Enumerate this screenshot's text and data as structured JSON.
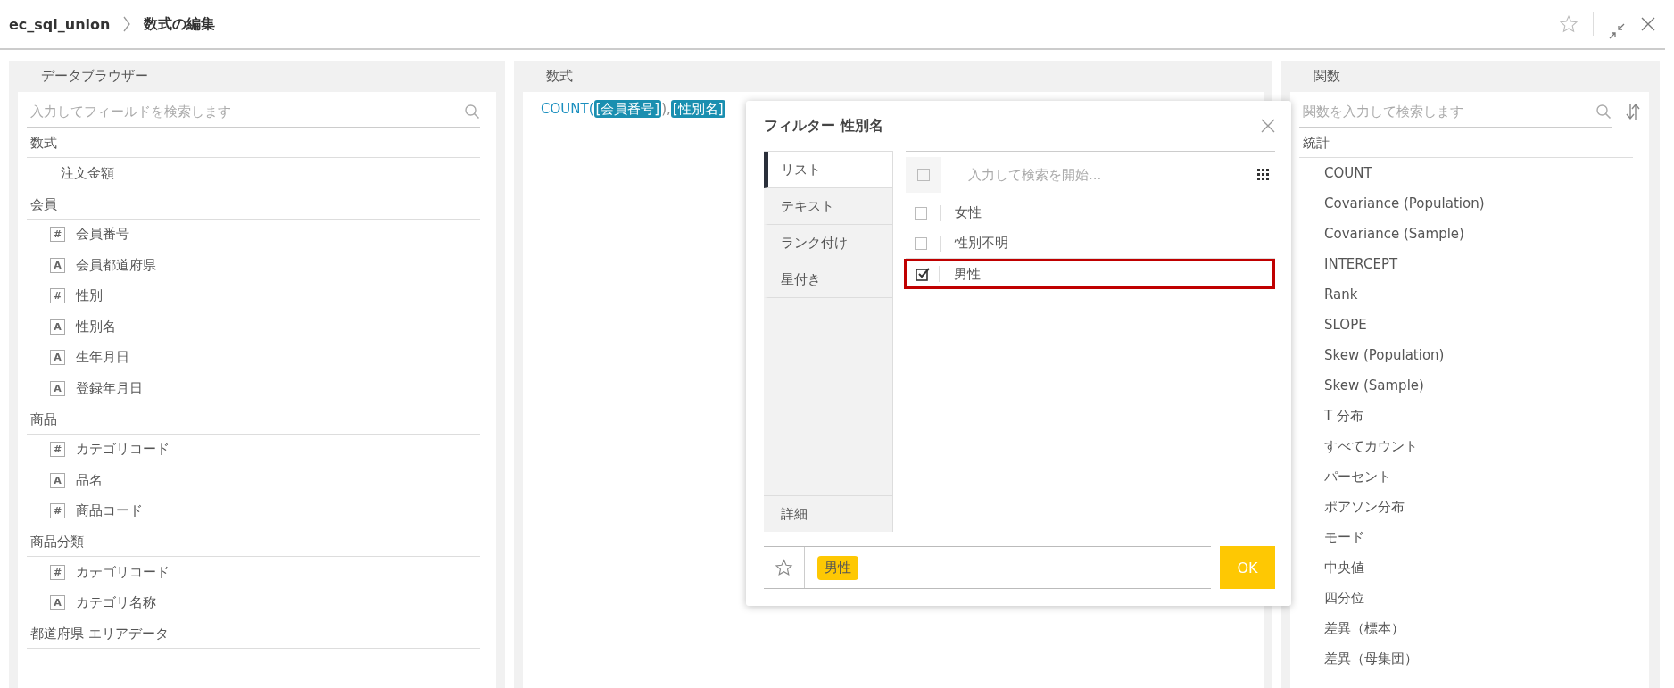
{
  "breadcrumb": [
    "ec_sql_union",
    "数式の編集"
  ],
  "data_browser": {
    "title": "データブラウザー",
    "search": {
      "placeholder": "入力してフィールドを検索します"
    },
    "groups": [
      {
        "name": "数式",
        "fields": [
          {
            "name": "注文金額"
          }
        ]
      },
      {
        "name": "会員",
        "fields": [
          {
            "type_icon": "#",
            "name": "会員番号"
          },
          {
            "type_icon": "A",
            "name": "会員都道府県"
          },
          {
            "type_icon": "#",
            "name": "性別"
          },
          {
            "type_icon": "A",
            "name": "性別名"
          },
          {
            "type_icon": "A",
            "name": "生年月日"
          },
          {
            "type_icon": "A",
            "name": "登録年月日"
          }
        ]
      },
      {
        "name": "商品",
        "fields": [
          {
            "type_icon": "#",
            "name": "カテゴリコード"
          },
          {
            "type_icon": "A",
            "name": "品名"
          },
          {
            "type_icon": "#",
            "name": "商品コード"
          }
        ]
      },
      {
        "name": "商品分類",
        "fields": [
          {
            "type_icon": "#",
            "name": "カテゴリコード"
          },
          {
            "type_icon": "A",
            "name": "カテゴリ名称"
          }
        ]
      },
      {
        "name": "都道府県 エリアデータ"
      }
    ]
  },
  "formula": {
    "title": "数式",
    "tokens": [
      {
        "kind": "function",
        "text": "COUNT("
      },
      {
        "kind": "field",
        "text": "[会員番号]"
      },
      {
        "kind": "plain",
        "text": "),"
      },
      {
        "kind": "field",
        "text": "[性別名]"
      }
    ]
  },
  "functions": {
    "title": "関数",
    "search": {
      "placeholder": "関数を入力して検索します"
    },
    "category": "統計",
    "items": [
      "COUNT",
      "Covariance (Population)",
      "Covariance (Sample)",
      "INTERCEPT",
      "Rank",
      "SLOPE",
      "Skew (Population)",
      "Skew (Sample)",
      "T 分布",
      "すべてカウント",
      "パーセント",
      "ポアソン分布",
      "モード",
      "中央値",
      "四分位",
      "差異（標本）",
      "差異（母集団）"
    ]
  },
  "filter": {
    "title": "フィルター 性別名",
    "tabs": [
      {
        "label": "リスト",
        "selected": true
      },
      {
        "label": "テキスト",
        "selected": false
      },
      {
        "label": "ランク付け",
        "selected": false
      },
      {
        "label": "星付き",
        "selected": false
      }
    ],
    "detail_tab": "詳細",
    "search": {
      "placeholder": "入力して検索を開始..."
    },
    "select_all": {
      "checked": false
    },
    "values": [
      {
        "label": "女性",
        "checked": false,
        "highlighted": false
      },
      {
        "label": "性別不明",
        "checked": false,
        "highlighted": false
      },
      {
        "label": "男性",
        "checked": true,
        "highlighted": true
      }
    ],
    "chips": [
      "男性"
    ],
    "ok": "OK"
  }
}
